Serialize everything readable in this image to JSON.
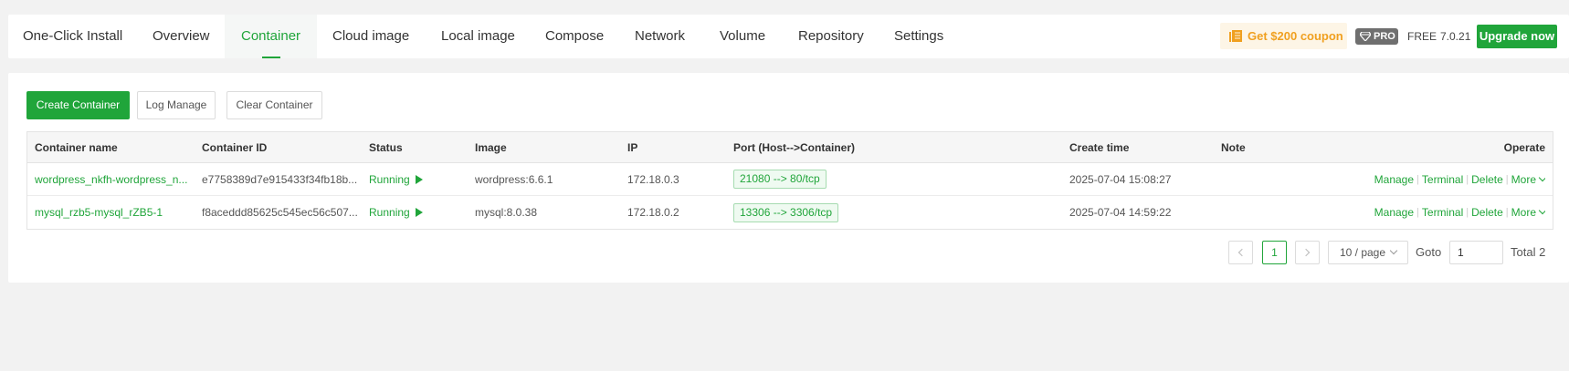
{
  "nav": {
    "tabs": [
      {
        "label": "One-Click Install"
      },
      {
        "label": "Overview"
      },
      {
        "label": "Container"
      },
      {
        "label": "Cloud image"
      },
      {
        "label": "Local image"
      },
      {
        "label": "Compose"
      },
      {
        "label": "Network"
      },
      {
        "label": "Volume"
      },
      {
        "label": "Repository"
      },
      {
        "label": "Settings"
      }
    ],
    "active_tab": "Container",
    "coupon": "Get $200 coupon",
    "pro_badge": "PRO",
    "free_label": "FREE",
    "version": "7.0.21",
    "upgrade": "Upgrade now"
  },
  "toolbar": {
    "create": "Create Container",
    "log_manage": "Log Manage",
    "clear": "Clear Container"
  },
  "table": {
    "columns": [
      "Container name",
      "Container ID",
      "Status",
      "Image",
      "IP",
      "Port (Host-->Container)",
      "Create time",
      "Note",
      "Operate"
    ],
    "rows": [
      {
        "name": "wordpress_nkfh-wordpress_n...",
        "id": "e7758389d7e915433f34fb18b...",
        "status": "Running",
        "image": "wordpress:6.6.1",
        "ip": "172.18.0.3",
        "port": "21080 --> 80/tcp",
        "create_time": "2025-07-04 15:08:27",
        "note": ""
      },
      {
        "name": "mysql_rzb5-mysql_rZB5-1",
        "id": "f8aceddd85625c545ec56c507...",
        "status": "Running",
        "image": "mysql:8.0.38",
        "ip": "172.18.0.2",
        "port": "13306 --> 3306/tcp",
        "create_time": "2025-07-04 14:59:22",
        "note": ""
      }
    ],
    "operations": [
      "Manage",
      "Terminal",
      "Delete",
      "More"
    ]
  },
  "pagination": {
    "current_page": "1",
    "page_size": "10 / page",
    "goto_label": "Goto",
    "goto_value": "1",
    "total": "Total 2"
  },
  "colors": {
    "accent": "#20a53a",
    "coupon": "#f0a020",
    "background": "#f2f2f2"
  }
}
